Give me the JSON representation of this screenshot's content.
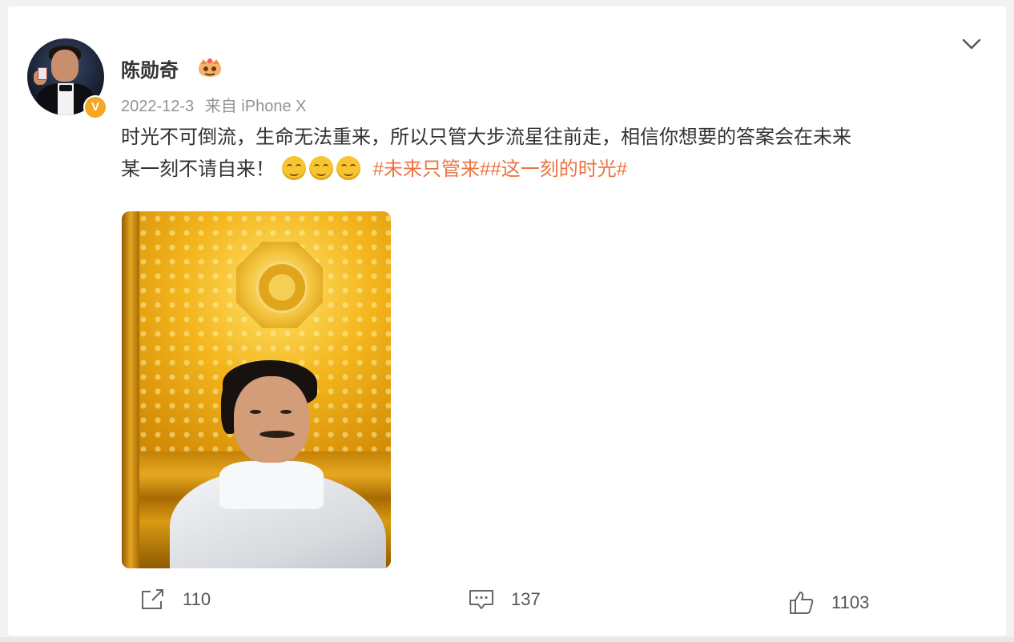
{
  "post": {
    "username": "陈勋奇",
    "date": "2022-12-3",
    "source": "来自 iPhone X",
    "text_line1": "时光不可倒流，生命无法重来，所以只管大步流星往前走，相信你想要的答案会在未来",
    "text_line2": "某一刻不请自来！",
    "hashtags": "#未来只管来##这一刻的时光#",
    "verified_mark": "V"
  },
  "actions": {
    "repost_count": "110",
    "comment_count": "137",
    "like_count": "1103"
  },
  "icons": {
    "menu": "chevron-down-icon",
    "repost": "share-icon",
    "comment": "comment-icon",
    "like": "thumbs-up-icon",
    "emoji": "hug-emoji-icon",
    "badge": "fan-rank-badge-icon"
  },
  "colors": {
    "hashtag": "#eb7340",
    "verified_badge": "#f5a623",
    "meta_text": "#939393",
    "body_text": "#333333"
  }
}
